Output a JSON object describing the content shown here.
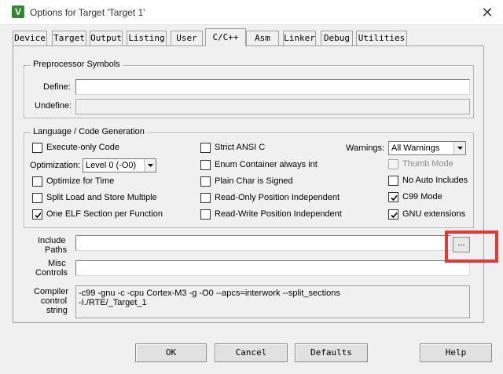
{
  "window": {
    "title": "Options for Target 'Target 1'",
    "app_icon_letter": "V",
    "close_glyph": "✕"
  },
  "tabs": [
    {
      "label": "Device"
    },
    {
      "label": "Target"
    },
    {
      "label": "Output"
    },
    {
      "label": "Listing"
    },
    {
      "label": "User"
    },
    {
      "label": "C/C++",
      "active": true
    },
    {
      "label": "Asm"
    },
    {
      "label": "Linker"
    },
    {
      "label": "Debug"
    },
    {
      "label": "Utilities"
    }
  ],
  "preprocessor": {
    "group_title": "Preprocessor Symbols",
    "define_label": "Define:",
    "define_value": "",
    "undefine_label": "Undefine:",
    "undefine_value": ""
  },
  "language": {
    "group_title": "Language / Code Generation",
    "execute_only": {
      "label": "Execute-only Code",
      "checked": false
    },
    "optimization_label": "Optimization:",
    "optimization_value": "Level 0 (-O0)",
    "optimize_time": {
      "label": "Optimize for Time",
      "checked": false
    },
    "split_load": {
      "label": "Split Load and Store Multiple",
      "checked": false
    },
    "one_elf": {
      "label": "One ELF Section per Function",
      "checked": true
    },
    "strict_ansi": {
      "label": "Strict ANSI C",
      "checked": false
    },
    "enum_container": {
      "label": "Enum Container always int",
      "checked": false
    },
    "plain_char": {
      "label": "Plain Char is Signed",
      "checked": false
    },
    "ro_pos": {
      "label": "Read-Only Position Independent",
      "checked": false
    },
    "rw_pos": {
      "label": "Read-Write Position Independent",
      "checked": false
    },
    "warnings_label": "Warnings:",
    "warnings_value": "All Warnings",
    "thumb_mode": {
      "label": "Thumb Mode",
      "checked": false,
      "disabled": true
    },
    "no_auto_includes": {
      "label": "No Auto Includes",
      "checked": false
    },
    "c99_mode": {
      "label": "C99 Mode",
      "checked": true
    },
    "gnu_extensions": {
      "label": "GNU extensions",
      "checked": true
    }
  },
  "include": {
    "label_line1": "Include",
    "label_line2": "Paths",
    "value": "",
    "browse_label": "..."
  },
  "misc": {
    "label_line1": "Misc",
    "label_line2": "Controls",
    "value": ""
  },
  "compiler": {
    "label_line1": "Compiler",
    "label_line2": "control",
    "label_line3": "string",
    "line1": "-c99 -gnu -c -cpu Cortex-M3 -g -O0 --apcs=interwork --split_sections",
    "line2": "-I./RTE/_Target_1"
  },
  "buttons": {
    "ok": "OK",
    "cancel": "Cancel",
    "defaults": "Defaults",
    "help": "Help"
  },
  "colors": {
    "highlight": "#e53935",
    "app_icon": "#2e8b2e"
  }
}
